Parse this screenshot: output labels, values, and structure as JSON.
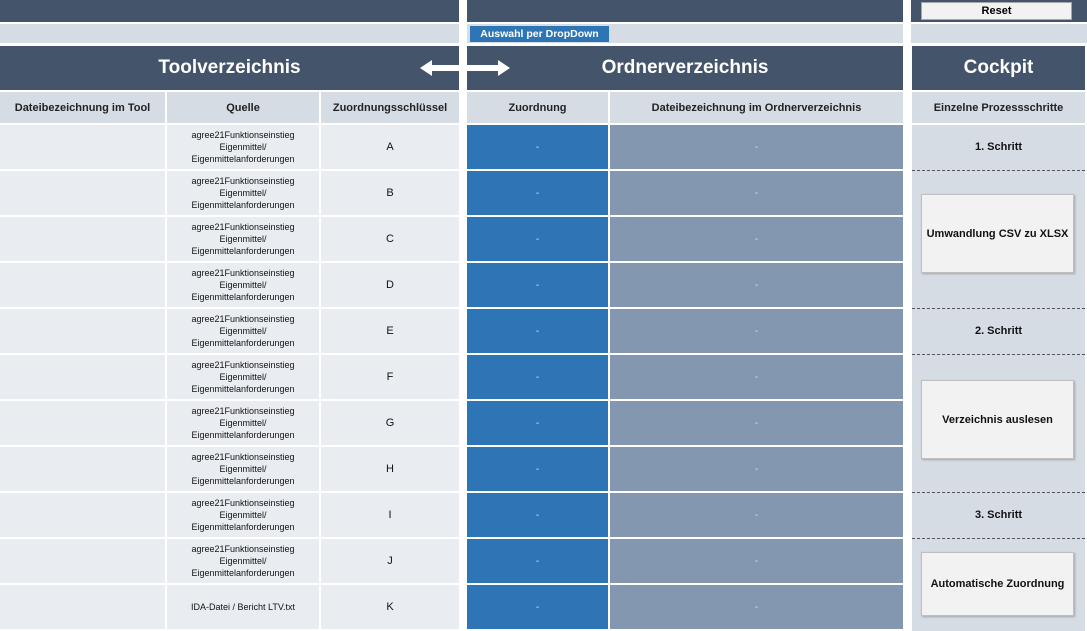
{
  "toolbar": {
    "reset_label": "Reset",
    "dropdown_label": "Auswahl per DropDown"
  },
  "sections": {
    "tool_title": "Toolverzeichnis",
    "ordner_title": "Ordnerverzeichnis",
    "cockpit_title": "Cockpit"
  },
  "columns": {
    "dateibezeichnung_tool": "Dateibezeichnung im Tool",
    "quelle": "Quelle",
    "zuordnungsschluessel": "Zuordnungsschlüssel",
    "zuordnung": "Zuordnung",
    "dateibezeichnung_ordner": "Dateibezeichnung im Ordnerverzeichnis",
    "prozessschritte": "Einzelne Prozessschritte"
  },
  "rows": [
    {
      "name": "",
      "quelle": "agree21Funktionseinstieg\nEigenmittel/\nEigenmittelanforderungen",
      "key": "A",
      "zuordnung": "-",
      "datei": "-"
    },
    {
      "name": "",
      "quelle": "agree21Funktionseinstieg\nEigenmittel/\nEigenmittelanforderungen",
      "key": "B",
      "zuordnung": "-",
      "datei": "-"
    },
    {
      "name": "",
      "quelle": "agree21Funktionseinstieg\nEigenmittel/\nEigenmittelanforderungen",
      "key": "C",
      "zuordnung": "-",
      "datei": "-"
    },
    {
      "name": "",
      "quelle": "agree21Funktionseinstieg\nEigenmittel/\nEigenmittelanforderungen",
      "key": "D",
      "zuordnung": "-",
      "datei": "-"
    },
    {
      "name": "",
      "quelle": "agree21Funktionseinstieg\nEigenmittel/\nEigenmittelanforderungen",
      "key": "E",
      "zuordnung": "-",
      "datei": "-"
    },
    {
      "name": "",
      "quelle": "agree21Funktionseinstieg\nEigenmittel/\nEigenmittelanforderungen",
      "key": "F",
      "zuordnung": "-",
      "datei": "-"
    },
    {
      "name": "",
      "quelle": "agree21Funktionseinstieg\nEigenmittel/\nEigenmittelanforderungen",
      "key": "G",
      "zuordnung": "-",
      "datei": "-"
    },
    {
      "name": "",
      "quelle": "agree21Funktionseinstieg\nEigenmittel/\nEigenmittelanforderungen",
      "key": "H",
      "zuordnung": "-",
      "datei": "-"
    },
    {
      "name": "",
      "quelle": "agree21Funktionseinstieg\nEigenmittel/\nEigenmittelanforderungen",
      "key": "I",
      "zuordnung": "-",
      "datei": "-"
    },
    {
      "name": "",
      "quelle": "agree21Funktionseinstieg\nEigenmittel/\nEigenmittelanforderungen",
      "key": "J",
      "zuordnung": "-",
      "datei": "-"
    },
    {
      "name": "",
      "quelle": "IDA-Datei / Bericht LTV.txt",
      "key": "K",
      "zuordnung": "-",
      "datei": "-"
    }
  ],
  "cockpit": {
    "step1_label": "1. Schritt",
    "step1_button": "Umwandlung CSV zu XLSX",
    "step2_label": "2. Schritt",
    "step2_button": "Verzeichnis auslesen",
    "step3_label": "3. Schritt",
    "step3_button": "Automatische Zuordnung"
  },
  "icons": {
    "arrow": "double-arrow-icon"
  },
  "colors": {
    "header_dark": "#44546a",
    "header_light": "#d6dce4",
    "cell_bg": "#e9edf2",
    "zuordnung_blue": "#2e75b6",
    "datei_gray": "#8497b0"
  }
}
